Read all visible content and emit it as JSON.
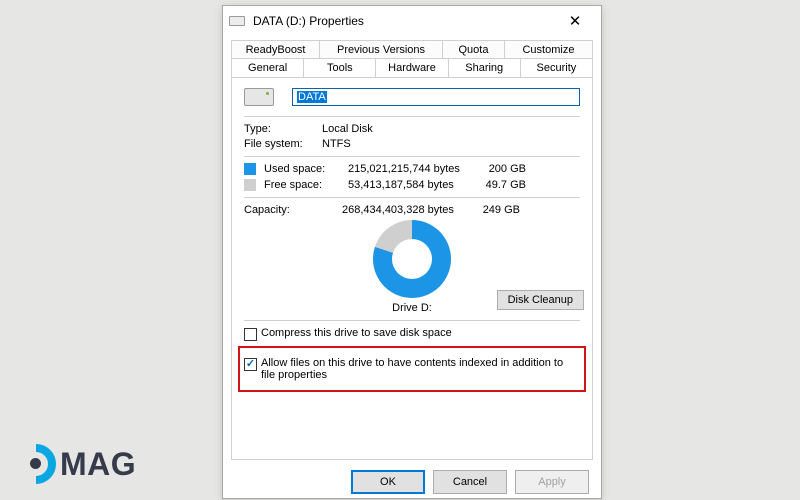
{
  "window": {
    "title": "DATA (D:) Properties"
  },
  "tabs_row1": [
    {
      "label": "ReadyBoost"
    },
    {
      "label": "Previous Versions"
    },
    {
      "label": "Quota"
    },
    {
      "label": "Customize"
    }
  ],
  "tabs_row2": [
    {
      "label": "General",
      "active": true
    },
    {
      "label": "Tools"
    },
    {
      "label": "Hardware"
    },
    {
      "label": "Sharing"
    },
    {
      "label": "Security"
    }
  ],
  "name_field": {
    "value": "DATA"
  },
  "info": {
    "type_label": "Type:",
    "type_value": "Local Disk",
    "fs_label": "File system:",
    "fs_value": "NTFS"
  },
  "space": {
    "used_label": "Used space:",
    "used_bytes": "215,021,215,744 bytes",
    "used_hr": "200 GB",
    "free_label": "Free space:",
    "free_bytes": "53,413,187,584 bytes",
    "free_hr": "49.7 GB",
    "capacity_label": "Capacity:",
    "capacity_bytes": "268,434,403,328 bytes",
    "capacity_hr": "249 GB"
  },
  "chart_data": {
    "type": "pie",
    "title": "Drive D:",
    "series": [
      {
        "name": "Used space",
        "value": 215021215744,
        "hr": "200 GB",
        "color": "#1d95e6"
      },
      {
        "name": "Free space",
        "value": 53413187584,
        "hr": "49.7 GB",
        "color": "#cfcfcf"
      }
    ],
    "total": 268434403328
  },
  "drive_label": "Drive D:",
  "buttons": {
    "disk_cleanup": "Disk Cleanup",
    "ok": "OK",
    "cancel": "Cancel",
    "apply": "Apply"
  },
  "checkboxes": {
    "compress": {
      "checked": false,
      "label": "Compress this drive to save disk space"
    },
    "index": {
      "checked": true,
      "label": "Allow files on this drive to have contents indexed in addition to file properties"
    }
  },
  "watermark": "MAG"
}
